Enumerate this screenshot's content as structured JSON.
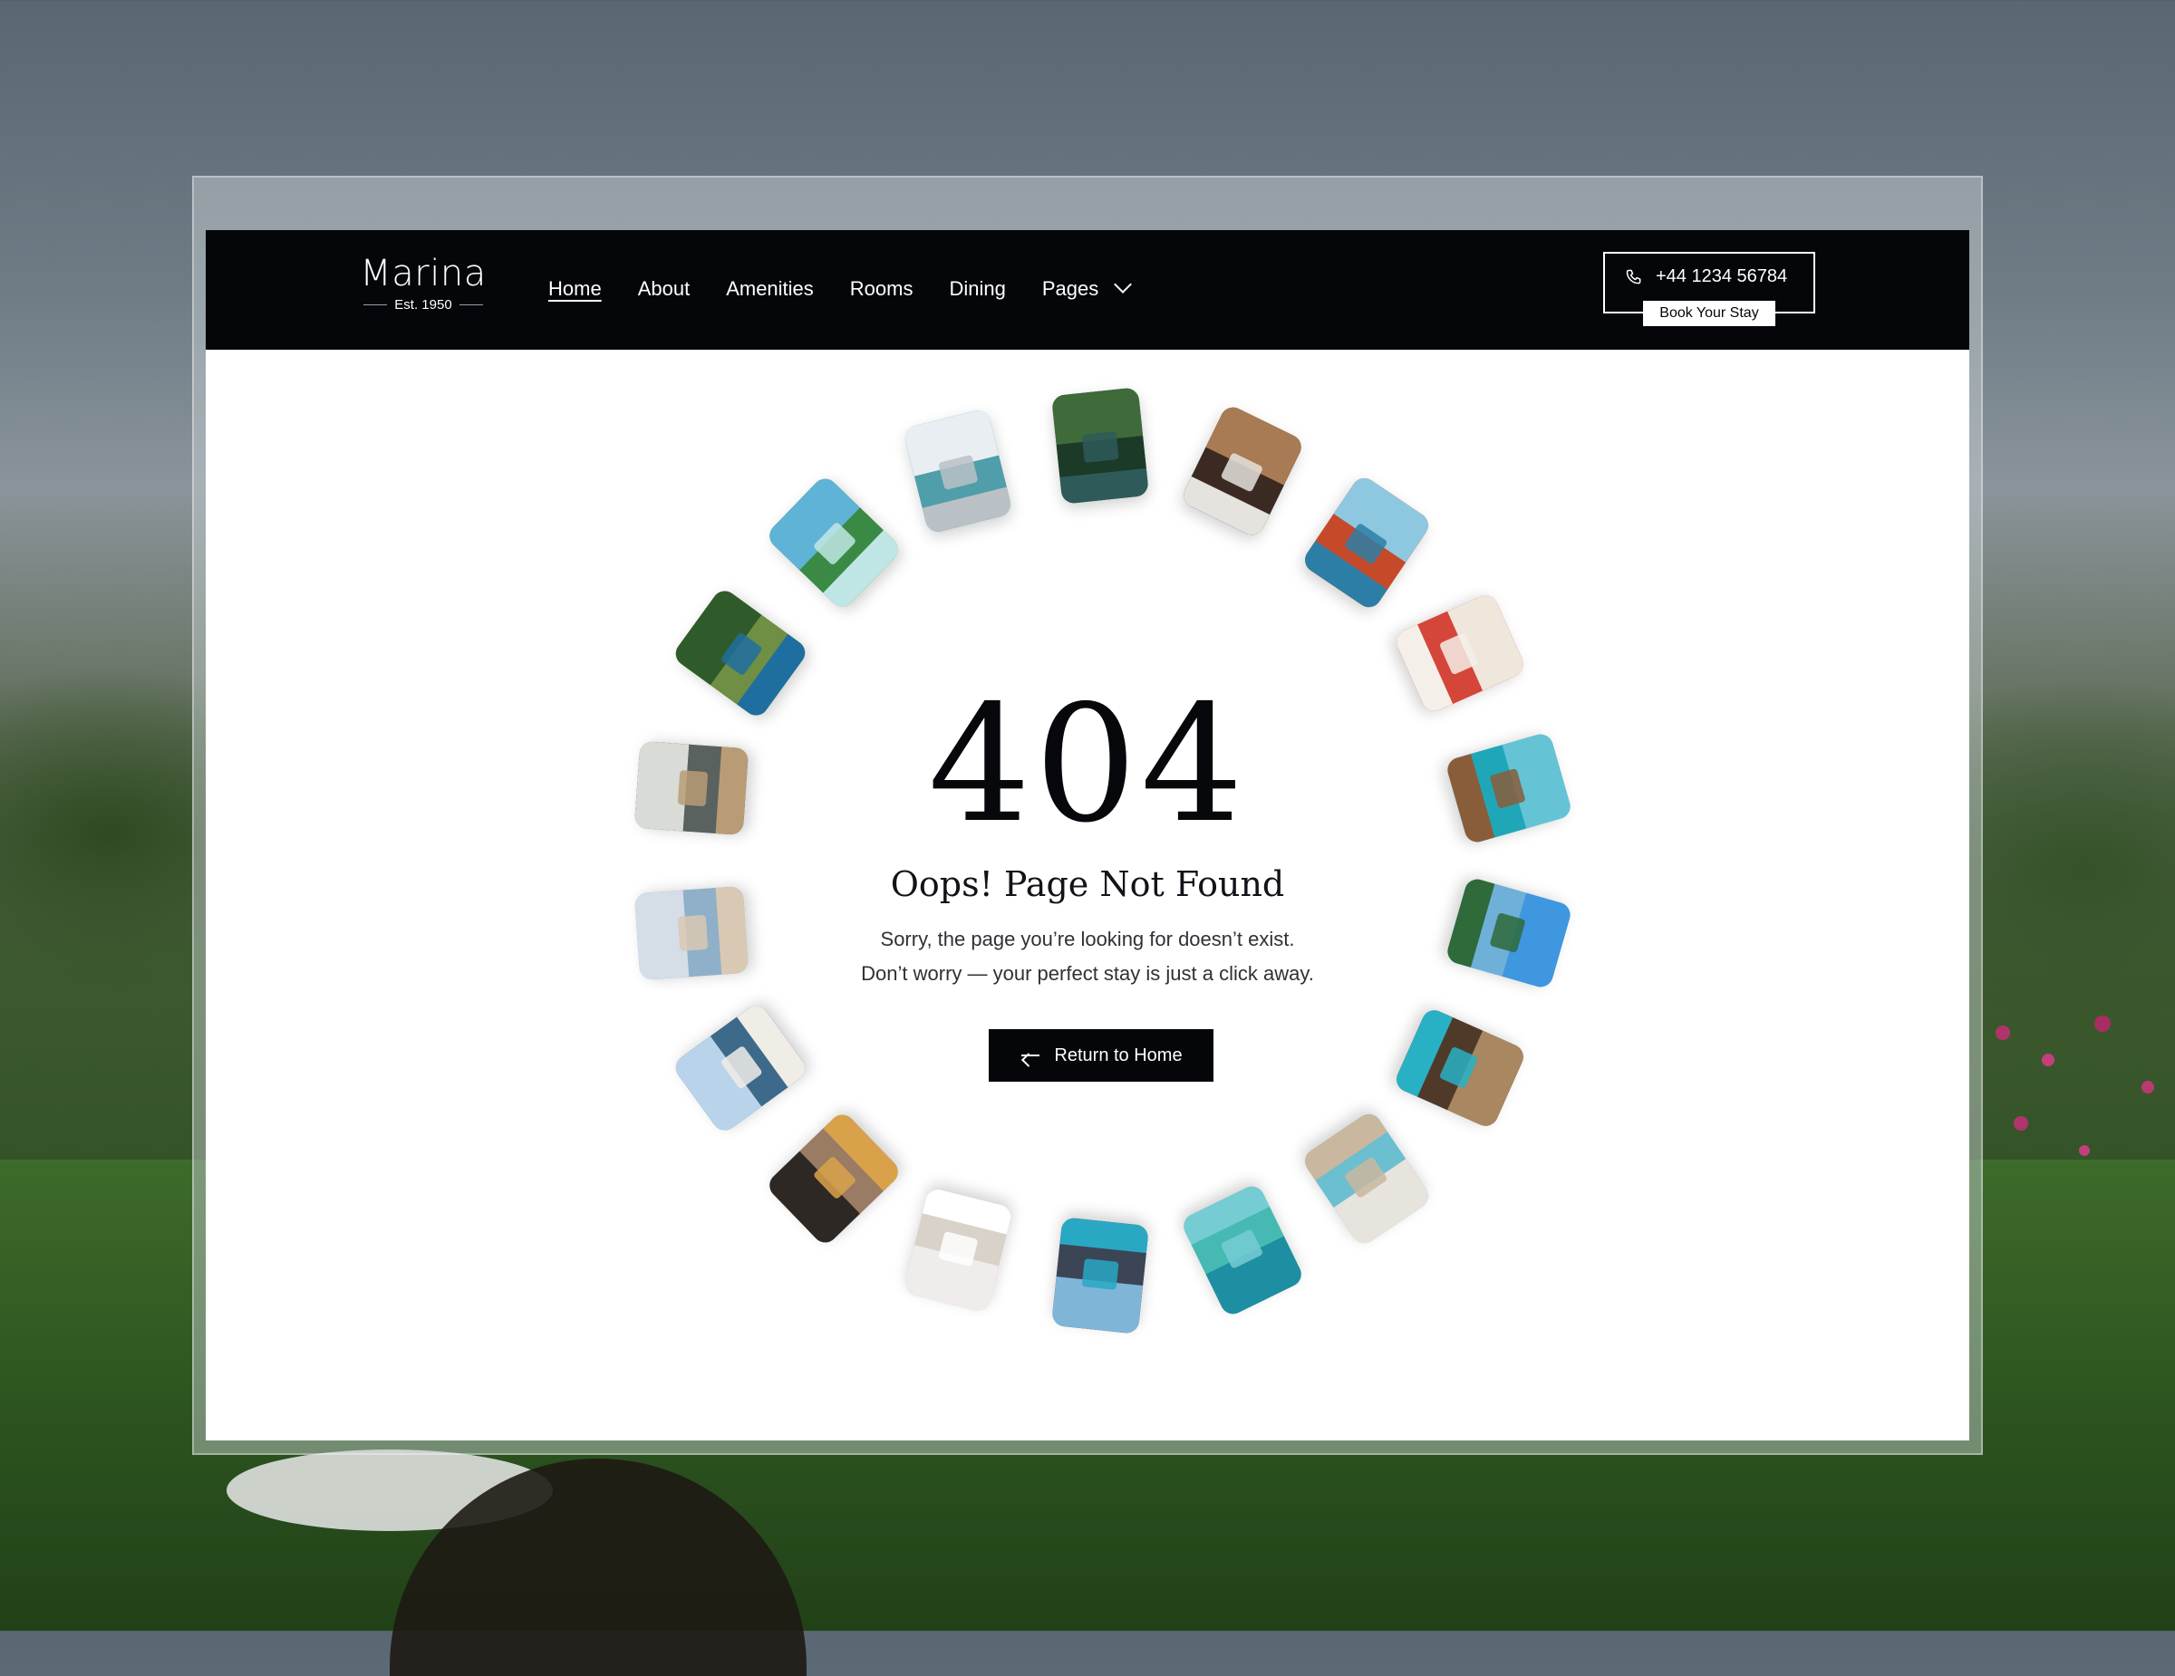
{
  "brand": {
    "name": "Marina",
    "established": "Est. 1950"
  },
  "nav": {
    "items": [
      {
        "label": "Home",
        "active": true
      },
      {
        "label": "About",
        "active": false
      },
      {
        "label": "Amenities",
        "active": false
      },
      {
        "label": "Rooms",
        "active": false
      },
      {
        "label": "Dining",
        "active": false
      },
      {
        "label": "Pages",
        "active": false,
        "has_dropdown": true
      }
    ]
  },
  "contact": {
    "phone": "+44 1234 56784",
    "book_label": "Book Your Stay",
    "icon": "phone-icon"
  },
  "error": {
    "code": "404",
    "title": "Oops! Page Not Found",
    "line1": "Sorry, the page you’re looking for doesn’t exist.",
    "line2": "Don’t worry — your perfect stay is just a click away.",
    "button_label": "Return to Home",
    "button_icon": "arrow-left-icon"
  },
  "gallery": {
    "photos": [
      {
        "name": "palm-pool-photo",
        "colors": [
          "#3f6a3a",
          "#1c3a28",
          "#2e5b59"
        ]
      },
      {
        "name": "chef-dish-photo",
        "colors": [
          "#a87b55",
          "#3b2a22",
          "#e6e2dd"
        ]
      },
      {
        "name": "poolside-loungers-photo",
        "colors": [
          "#8ec8e0",
          "#c44a2a",
          "#2d7ea6"
        ]
      },
      {
        "name": "rose-petal-bed-photo",
        "colors": [
          "#efe6dc",
          "#d5463a",
          "#f5efe9"
        ]
      },
      {
        "name": "ocean-balcony-photo",
        "colors": [
          "#64c4d6",
          "#1fa7b8",
          "#8a5d3a"
        ]
      },
      {
        "name": "glass-villa-photo",
        "colors": [
          "#3f97e0",
          "#6fb0d9",
          "#2f6a3a"
        ]
      },
      {
        "name": "stilt-villas-photo",
        "colors": [
          "#a98761",
          "#4f3a2a",
          "#28b1c4"
        ]
      },
      {
        "name": "beach-cabana-photo",
        "colors": [
          "#e7e3dd",
          "#6bbfd0",
          "#c9b79f"
        ]
      },
      {
        "name": "aerial-island-photo",
        "colors": [
          "#1e8fa2",
          "#46b9b3",
          "#76ccd3"
        ]
      },
      {
        "name": "resort-pool-photo",
        "colors": [
          "#7fb6d8",
          "#3b4556",
          "#29a8c4"
        ]
      },
      {
        "name": "white-bedroom-photo",
        "colors": [
          "#efeceb",
          "#d8d2c8",
          "#ffffff"
        ]
      },
      {
        "name": "dining-table-photo",
        "colors": [
          "#2e2824",
          "#9a7b63",
          "#d9a24a"
        ]
      },
      {
        "name": "blue-bedroom-photo",
        "colors": [
          "#b9d4ea",
          "#3d6a8a",
          "#f0ece6"
        ]
      },
      {
        "name": "beach-couple-photo",
        "colors": [
          "#d5dde7",
          "#8fb0c8",
          "#d9c9b4"
        ]
      },
      {
        "name": "modern-suite-photo",
        "colors": [
          "#d8dbd6",
          "#59625e",
          "#b99c76"
        ]
      },
      {
        "name": "jungle-villa-photo",
        "colors": [
          "#2f5a2a",
          "#6e8f44",
          "#1f6ea0"
        ]
      },
      {
        "name": "tropical-island-photo",
        "colors": [
          "#5fb3d6",
          "#3a8a45",
          "#bfe6e4"
        ]
      },
      {
        "name": "living-room-photo",
        "colors": [
          "#e9eef2",
          "#4f9eaa",
          "#b9c1c6"
        ]
      }
    ]
  }
}
